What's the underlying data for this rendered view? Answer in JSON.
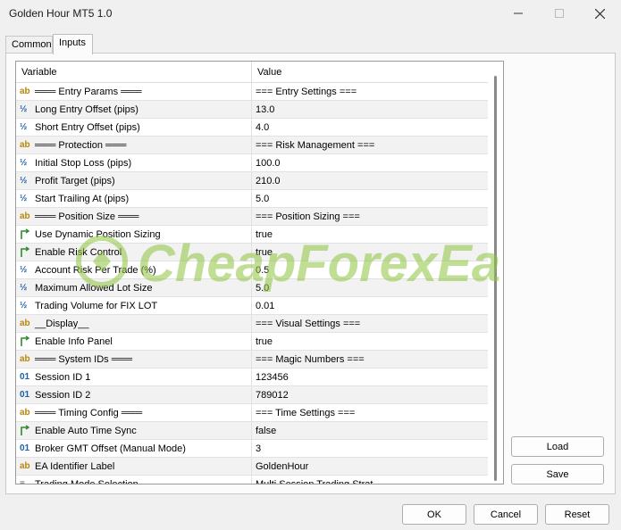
{
  "window": {
    "title": "Golden Hour MT5 1.0"
  },
  "tabs": [
    {
      "label": "Common",
      "active": false
    },
    {
      "label": "Inputs",
      "active": true
    }
  ],
  "grid": {
    "columns": {
      "variable": "Variable",
      "value": "Value"
    },
    "rows": [
      {
        "icon": "ab",
        "name": "═══ Entry Params ═══",
        "value": "=== Entry Settings ==="
      },
      {
        "icon": "half",
        "name": "Long Entry Offset (pips)",
        "value": "13.0"
      },
      {
        "icon": "half",
        "name": "Short Entry Offset (pips)",
        "value": "4.0"
      },
      {
        "icon": "ab",
        "name": "═══ Protection ═══",
        "value": "=== Risk Management ==="
      },
      {
        "icon": "half",
        "name": "Initial Stop Loss (pips)",
        "value": "100.0"
      },
      {
        "icon": "half",
        "name": "Profit Target (pips)",
        "value": "210.0"
      },
      {
        "icon": "half",
        "name": "Start Trailing At (pips)",
        "value": "5.0"
      },
      {
        "icon": "ab",
        "name": "═══ Position Size ═══",
        "value": "=== Position Sizing ==="
      },
      {
        "icon": "bool",
        "name": "Use Dynamic Position Sizing",
        "value": "true"
      },
      {
        "icon": "bool",
        "name": "Enable Risk Control",
        "value": "true"
      },
      {
        "icon": "half",
        "name": "Account Risk Per Trade (%)",
        "value": "0.5"
      },
      {
        "icon": "half",
        "name": "Maximum Allowed Lot Size",
        "value": "5.0"
      },
      {
        "icon": "half",
        "name": "Trading Volume for FIX LOT",
        "value": "0.01"
      },
      {
        "icon": "ab",
        "name": "__Display__",
        "value": "=== Visual Settings ==="
      },
      {
        "icon": "bool",
        "name": "Enable Info Panel",
        "value": "true"
      },
      {
        "icon": "ab",
        "name": "═══ System IDs ═══",
        "value": "=== Magic Numbers ==="
      },
      {
        "icon": "01",
        "name": "Session ID 1",
        "value": "123456"
      },
      {
        "icon": "01",
        "name": "Session ID 2",
        "value": "789012"
      },
      {
        "icon": "ab",
        "name": "═══ Timing Config ═══",
        "value": "=== Time Settings ==="
      },
      {
        "icon": "bool",
        "name": "Enable Auto Time Sync",
        "value": "false"
      },
      {
        "icon": "01",
        "name": "Broker GMT Offset (Manual Mode)",
        "value": "3"
      },
      {
        "icon": "ab",
        "name": "EA Identifier Label",
        "value": "GoldenHour"
      },
      {
        "icon": "enum",
        "name": "Trading Mode Selection",
        "value": "Multi Session Trading Strat"
      }
    ]
  },
  "side_buttons": {
    "load": "Load",
    "save": "Save"
  },
  "footer_buttons": {
    "ok": "OK",
    "cancel": "Cancel",
    "reset": "Reset"
  },
  "watermark": {
    "text": "CheapForexEa",
    "color": "#8dc63f"
  },
  "icons": {
    "minimize": "minimize-icon",
    "maximize": "maximize-icon",
    "close": "close-icon"
  }
}
